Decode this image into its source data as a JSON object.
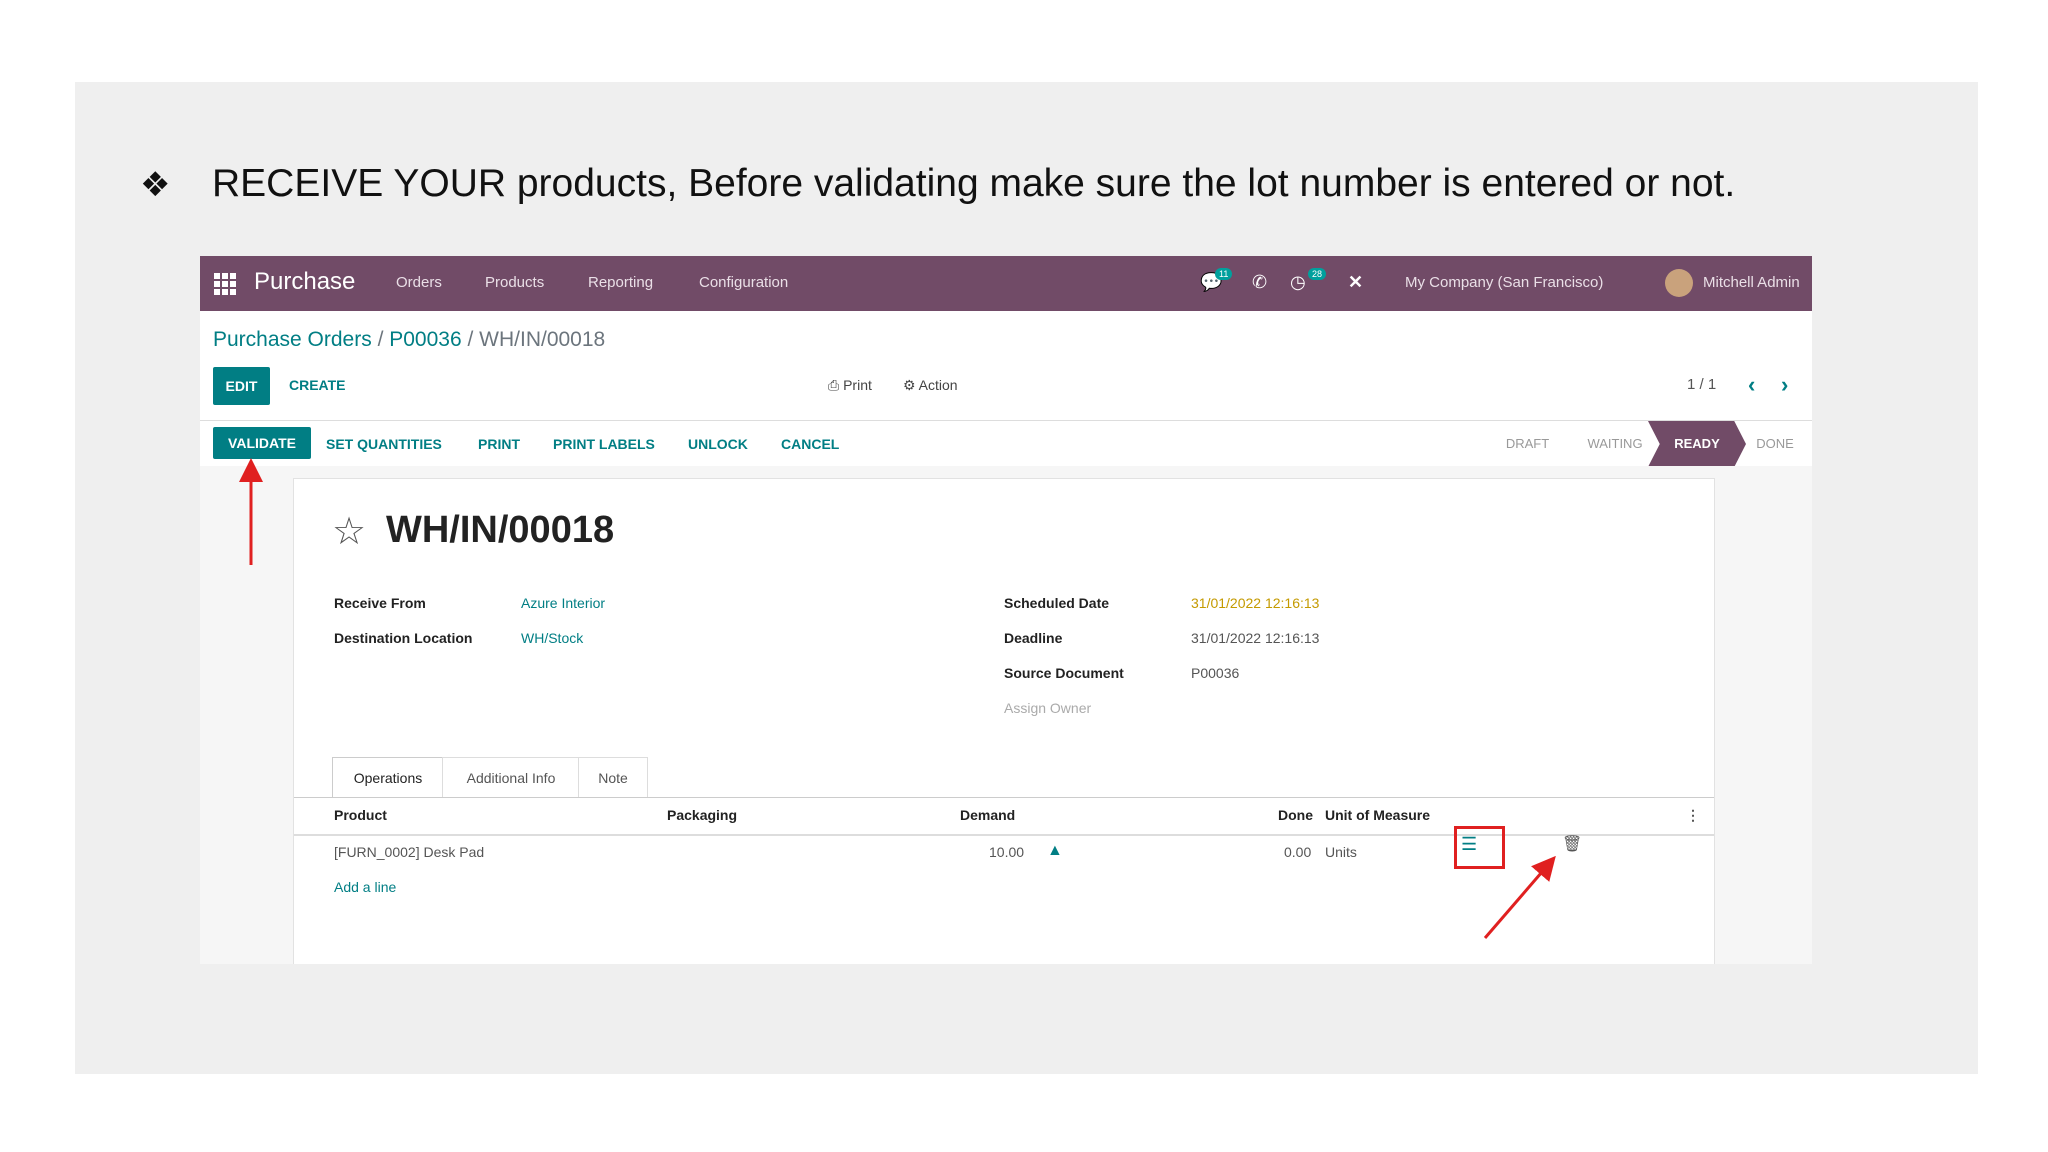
{
  "caption": {
    "bullet": "❖",
    "text": "RECEIVE YOUR products, Before validating make sure the lot number is entered or not."
  },
  "navbar": {
    "brand": "Purchase",
    "menu": [
      "Orders",
      "Products",
      "Reporting",
      "Configuration"
    ],
    "messages_badge": "11",
    "activity_badge": "28",
    "company": "My Company (San Francisco)",
    "user": "Mitchell Admin"
  },
  "breadcrumb": {
    "items": [
      "Purchase Orders",
      "P00036"
    ],
    "current": "WH/IN/00018",
    "separator": " / "
  },
  "controls": {
    "edit": "EDIT",
    "create": "CREATE",
    "print": "Print",
    "action": "Action",
    "pager": "1 / 1"
  },
  "status_buttons": [
    "VALIDATE",
    "SET QUANTITIES",
    "PRINT",
    "PRINT LABELS",
    "UNLOCK",
    "CANCEL"
  ],
  "stages": [
    "DRAFT",
    "WAITING",
    "READY",
    "DONE"
  ],
  "active_stage": "READY",
  "record": {
    "title": "WH/IN/00018",
    "receive_from_label": "Receive From",
    "receive_from": "Azure Interior",
    "destination_label": "Destination Location",
    "destination": "WH/Stock",
    "scheduled_label": "Scheduled Date",
    "scheduled": "31/01/2022 12:16:13",
    "deadline_label": "Deadline",
    "deadline": "31/01/2022 12:16:13",
    "source_label": "Source Document",
    "source": "P00036",
    "assign_owner": "Assign Owner"
  },
  "tabs": [
    "Operations",
    "Additional Info",
    "Note"
  ],
  "table": {
    "columns": [
      "Product",
      "Packaging",
      "Demand",
      "Done",
      "Unit of Measure"
    ],
    "rows": [
      {
        "product": "[FURN_0002] Desk Pad",
        "demand": "10.00",
        "done": "0.00",
        "uom": "Units"
      }
    ],
    "add_line": "Add a line"
  },
  "colors": {
    "brand": "#714b67",
    "accent": "#017e84",
    "highlight": "#e02020",
    "date_warning": "#c49a00"
  }
}
